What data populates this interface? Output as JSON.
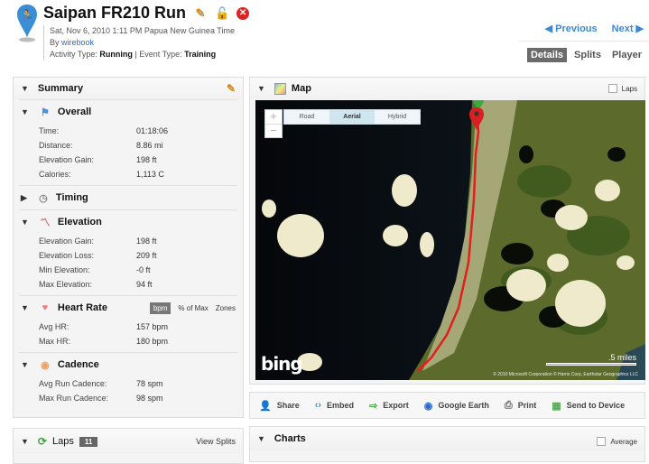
{
  "header": {
    "title": "Saipan FR210 Run",
    "datetime": "Sat, Nov 6, 2010 1:11 PM Papua New Guinea Time",
    "by_label": "By",
    "author": "wirebook",
    "activity_type_label": "Activity Type:",
    "activity_type": "Running",
    "event_type_label": "| Event Type:",
    "event_type": "Training",
    "prev_label": "Previous",
    "next_label": "Next",
    "tabs": [
      {
        "label": "Details",
        "active": true
      },
      {
        "label": "Splits",
        "active": false
      },
      {
        "label": "Player",
        "active": false
      }
    ]
  },
  "summary": {
    "title": "Summary",
    "overall": {
      "title": "Overall",
      "rows": [
        {
          "k": "Time:",
          "v": "01:18:06"
        },
        {
          "k": "Distance:",
          "v": "8.86 mi"
        },
        {
          "k": "Elevation Gain:",
          "v": "198 ft"
        },
        {
          "k": "Calories:",
          "v": "1,113 C"
        }
      ]
    },
    "timing": {
      "title": "Timing"
    },
    "elevation": {
      "title": "Elevation",
      "rows": [
        {
          "k": "Elevation Gain:",
          "v": "198 ft"
        },
        {
          "k": "Elevation Loss:",
          "v": "209 ft"
        },
        {
          "k": "Min Elevation:",
          "v": "-0 ft"
        },
        {
          "k": "Max Elevation:",
          "v": "94 ft"
        }
      ]
    },
    "heart_rate": {
      "title": "Heart Rate",
      "tabs": [
        "bpm",
        "% of Max",
        "Zones"
      ],
      "rows": [
        {
          "k": "Avg HR:",
          "v": "157 bpm"
        },
        {
          "k": "Max HR:",
          "v": "180 bpm"
        }
      ]
    },
    "cadence": {
      "title": "Cadence",
      "rows": [
        {
          "k": "Avg Run Cadence:",
          "v": "78 spm"
        },
        {
          "k": "Max Run Cadence:",
          "v": "98 spm"
        }
      ]
    }
  },
  "laps": {
    "title": "Laps",
    "count": "11",
    "view_splits": "View Splits"
  },
  "map": {
    "title": "Map",
    "laps_label": "Laps",
    "types": [
      {
        "label": "Road",
        "active": false
      },
      {
        "label": "Aerial",
        "active": true
      },
      {
        "label": "Hybrid",
        "active": false
      }
    ],
    "scale_label": ".5 miles",
    "logo": "bing",
    "copyright": "© 2010 Microsoft Corporation   © Harris Corp, Earthstar Geographics LLC",
    "route_color": "#e0201c"
  },
  "actions": [
    {
      "label": "Share",
      "icon": "share-icon"
    },
    {
      "label": "Embed",
      "icon": "embed-icon"
    },
    {
      "label": "Export",
      "icon": "export-icon"
    },
    {
      "label": "Google Earth",
      "icon": "google-earth-icon"
    },
    {
      "label": "Print",
      "icon": "print-icon"
    },
    {
      "label": "Send to Device",
      "icon": "send-to-device-icon"
    }
  ],
  "charts": {
    "title": "Charts",
    "average_label": "Average"
  }
}
